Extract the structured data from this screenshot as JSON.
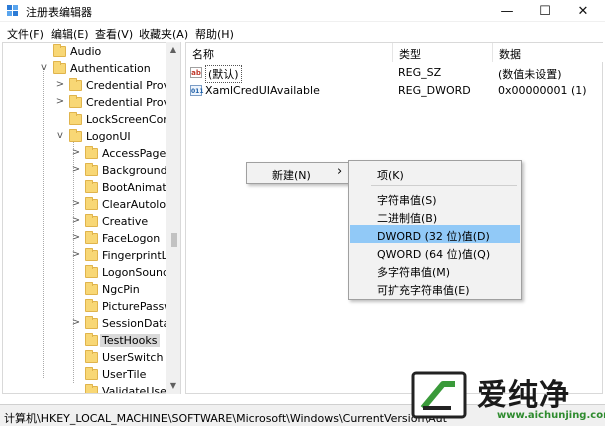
{
  "window": {
    "title": "注册表编辑器",
    "min_glyph": "—",
    "max_glyph": "☐",
    "close_glyph": "✕"
  },
  "menu": [
    "文件(F)",
    "编辑(E)",
    "查看(V)",
    "收藏夹(A)",
    "帮助(H)"
  ],
  "tree": {
    "items": [
      {
        "label": "Audio",
        "expander": ""
      },
      {
        "label": "Authentication",
        "expander": "v"
      },
      {
        "label": "Credential Provic",
        "expander": ">"
      },
      {
        "label": "Credential Provic",
        "expander": ">"
      },
      {
        "label": "LockScreenConte",
        "expander": ""
      },
      {
        "label": "LogonUI",
        "expander": "v"
      },
      {
        "label": "AccessPage",
        "expander": ">"
      },
      {
        "label": "Background",
        "expander": ">"
      },
      {
        "label": "BootAnimatio",
        "expander": ""
      },
      {
        "label": "ClearAutologo",
        "expander": ">"
      },
      {
        "label": "Creative",
        "expander": ">"
      },
      {
        "label": "FaceLogon",
        "expander": ">"
      },
      {
        "label": "FingerprintLo",
        "expander": ">"
      },
      {
        "label": "LogonSoundP",
        "expander": ""
      },
      {
        "label": "NgcPin",
        "expander": ""
      },
      {
        "label": "PicturePasswo",
        "expander": ""
      },
      {
        "label": "SessionData",
        "expander": ">"
      },
      {
        "label": "TestHooks",
        "expander": ""
      },
      {
        "label": "UserSwitch",
        "expander": ""
      },
      {
        "label": "UserTile",
        "expander": ""
      },
      {
        "label": "ValidateUserr",
        "expander": ""
      }
    ]
  },
  "values": {
    "columns": [
      "名称",
      "类型",
      "数据"
    ],
    "rows": [
      {
        "icon": "ab",
        "name": "(默认)",
        "type": "REG_SZ",
        "data": "(数值未设置)"
      },
      {
        "icon": "bin",
        "name": "XamlCredUIAvailable",
        "type": "REG_DWORD",
        "data": "0x00000001 (1)"
      }
    ]
  },
  "context_menu": {
    "new_label": "新建(N)",
    "arrow": "›"
  },
  "submenu": {
    "items": [
      "项(K)",
      "字符串值(S)",
      "二进制值(B)",
      "DWORD (32 位)值(D)",
      "QWORD (64 位)值(Q)",
      "多字符串值(M)",
      "可扩充字符串值(E)"
    ],
    "highlighted": "DWORD (32 位)值(D)",
    "highlight_color": "#91c9f7"
  },
  "status": {
    "path": "计算机\\HKEY_LOCAL_MACHINE\\SOFTWARE\\Microsoft\\Windows\\CurrentVersion\\Aut"
  },
  "watermark": {
    "title": "爱纯净",
    "url": "www.aichunjing.com",
    "accent": "#3a9a3a"
  }
}
